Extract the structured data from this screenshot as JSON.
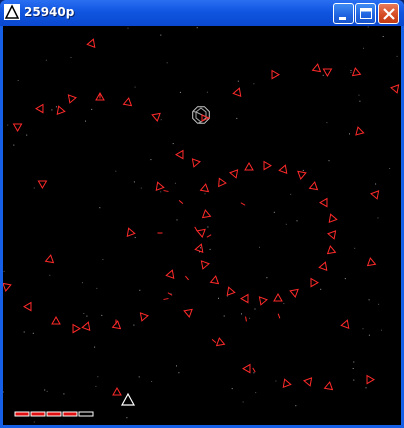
{
  "window": {
    "title": "25940p",
    "icon": "triangle-ship-icon",
    "controls": [
      "minimize-icon",
      "maximize-icon",
      "close-icon"
    ]
  },
  "hud": {
    "health_segments_total": 5,
    "health_segments_filled": 4
  },
  "colors": {
    "enemy": "#ff2a2a",
    "player": "#ffffff",
    "background": "#000000",
    "health_fill": "#e01010"
  }
}
